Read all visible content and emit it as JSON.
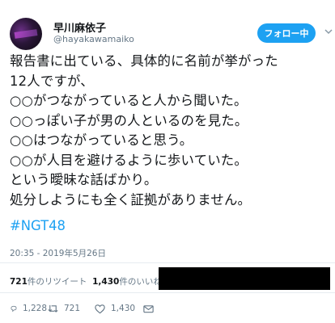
{
  "profile": {
    "name": "早川麻依子",
    "handle": "@hayakawamaiko",
    "follow_label": "フォロー中"
  },
  "tweet": {
    "lines": [
      "報告書に出ている、具体的に名前が挙がった",
      "12人ですが、",
      "○○がつながっていると人から聞いた。",
      "○○っぽい子が男の人といるのを見た。",
      "○○はつながっていると思う。",
      "○○が人目を避けるように歩いていた。",
      "という曖昧な話ばかり。",
      "処分しようにも全く証拠がありません。"
    ],
    "hashtag": "#NGT48",
    "timestamp": "20:35 - 2019年5月26日"
  },
  "stats": {
    "retweet_count": "721",
    "retweet_label": "件のリツイート",
    "like_count": "1,430",
    "like_label": "件のいいね"
  },
  "actions": {
    "reply_count": "1,228",
    "retweet_count": "721",
    "like_count": "1,430"
  },
  "colors": {
    "accent": "#1da1f2",
    "muted": "#657786"
  }
}
